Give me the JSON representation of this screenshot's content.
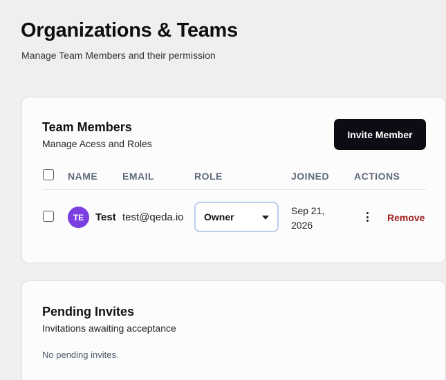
{
  "header": {
    "title": "Organizations & Teams",
    "subtitle": "Manage Team Members and their permission"
  },
  "members_card": {
    "title": "Team Members",
    "subtitle": "Manage Acess and Roles",
    "invite_label": "Invite Member",
    "columns": {
      "name": "NAME",
      "email": "EMAIL",
      "role": "ROLE",
      "joined": "JOINED",
      "actions": "ACTIONS"
    },
    "rows": [
      {
        "initials": "TE",
        "name": "Test",
        "email": "test@qeda.io",
        "role": "Owner",
        "joined_line1": "Sep 21,",
        "joined_line2": "2026",
        "more_icon": "kebab-icon",
        "remove_label": "Remove",
        "avatar_color": "#7b3ee0"
      }
    ]
  },
  "pending_card": {
    "title": "Pending Invites",
    "subtitle": "Invitations awaiting acceptance",
    "empty_text": "No pending invites."
  },
  "colors": {
    "background": "#efefef",
    "card": "#fdfcfc",
    "primary_button": "#0c0c14",
    "danger": "#a01d1d",
    "header_text": "#5f6b7a",
    "select_border": "#b8cdea"
  }
}
